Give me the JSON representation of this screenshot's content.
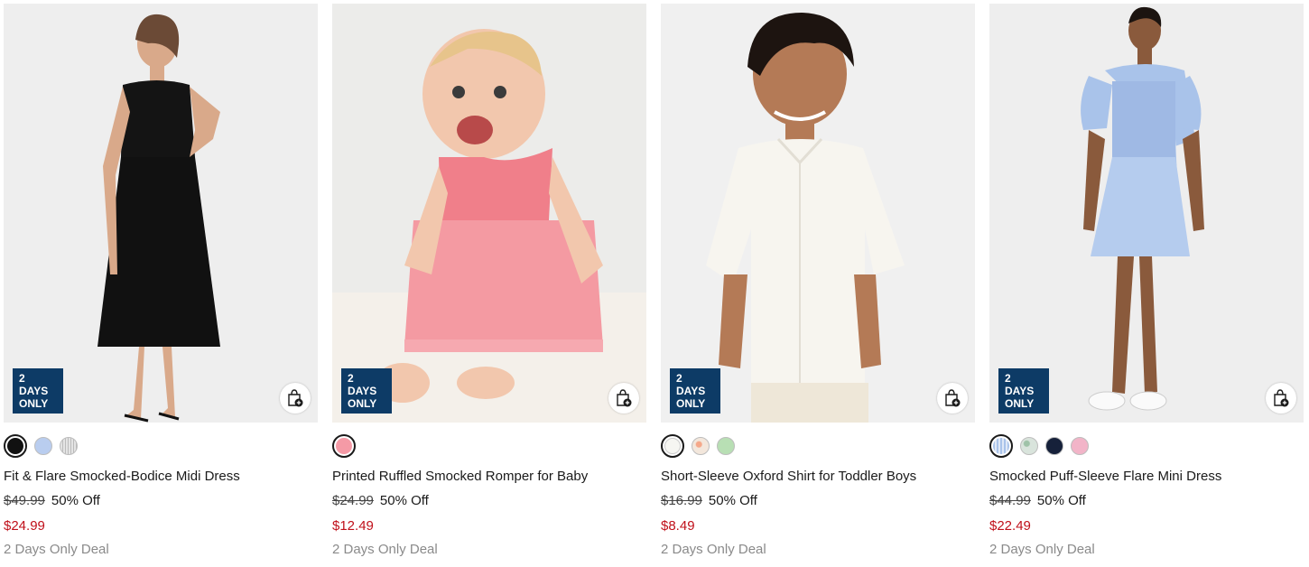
{
  "products": [
    {
      "badge": "2 DAYS\nONLY",
      "name": "Fit & Flare Smocked-Bodice Midi Dress",
      "original_price": "$49.99",
      "discount": "50% Off",
      "sale_price": "$24.99",
      "deal_label": "2 Days Only Deal",
      "image_bg": "#eeeeee",
      "swatches": [
        {
          "color": "#111111",
          "selected": true
        },
        {
          "color": "#b9cdef",
          "selected": false
        },
        {
          "color": "#e4e4e4",
          "selected": false
        }
      ]
    },
    {
      "badge": "2 DAYS\nONLY",
      "name": "Printed Ruffled Smocked Romper for Baby",
      "original_price": "$24.99",
      "discount": "50% Off",
      "sale_price": "$12.49",
      "deal_label": "2 Days Only Deal",
      "image_bg": "#ececea",
      "swatches": [
        {
          "color": "#f59aa6",
          "selected": true
        }
      ]
    },
    {
      "badge": "2 DAYS\nONLY",
      "name": "Short-Sleeve Oxford Shirt for Toddler Boys",
      "original_price": "$16.99",
      "discount": "50% Off",
      "sale_price": "$8.49",
      "deal_label": "2 Days Only Deal",
      "image_bg": "#f0f0f0",
      "swatches": [
        {
          "color": "#f6f6f2",
          "selected": true
        },
        {
          "color": "#f3e7dc",
          "selected": false
        },
        {
          "color": "#b8dfb4",
          "selected": false
        }
      ]
    },
    {
      "badge": "2 DAYS\nONLY",
      "name": "Smocked Puff-Sleeve Flare Mini Dress",
      "original_price": "$44.99",
      "discount": "50% Off",
      "sale_price": "$22.49",
      "deal_label": "2 Days Only Deal",
      "image_bg": "#eeeeee",
      "swatches": [
        {
          "color": "#a9c3ea",
          "selected": true
        },
        {
          "color": "#d9e4dc",
          "selected": false
        },
        {
          "color": "#16213a",
          "selected": false
        },
        {
          "color": "#f2b4c8",
          "selected": false
        }
      ]
    }
  ],
  "colors": {
    "badge_bg": "#0d3b66",
    "sale_price": "#c0101a",
    "deal_text": "#8a8a8a"
  },
  "icons": {
    "add_to_bag": "shopping-bag-plus-icon"
  }
}
